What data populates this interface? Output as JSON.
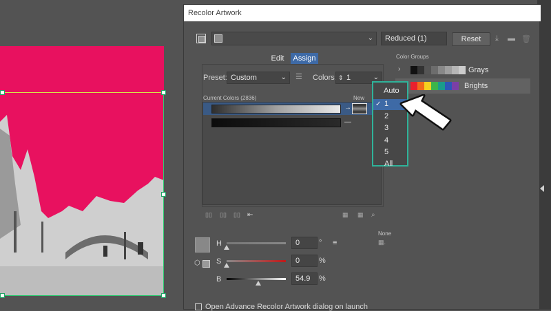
{
  "dialog": {
    "title": "Recolor Artwork",
    "preset_group_name": "Reduced (1)",
    "reset_label": "Reset",
    "tabs": {
      "edit": "Edit",
      "assign": "Assign"
    },
    "preset_label": "Preset:",
    "preset_value": "Custom",
    "colors_label": "Colors:",
    "colors_value": "1",
    "current_colors_label": "Current Colors (2836)",
    "new_label": "New",
    "none_label": "None",
    "checkbox_label": "Open Advance Recolor Artwork dialog on launch"
  },
  "color_groups": {
    "heading": "Color Groups",
    "items": [
      {
        "label": "Grays"
      },
      {
        "label": "Brights"
      }
    ]
  },
  "colors_dropdown": {
    "options": [
      "Auto",
      "1",
      "2",
      "3",
      "4",
      "5",
      "All"
    ],
    "selected": "1"
  },
  "hsb": {
    "h_label": "H",
    "h_value": "0",
    "h_unit": "°",
    "s_label": "S",
    "s_value": "0",
    "s_unit": "%",
    "b_label": "B",
    "b_value": "54.9",
    "b_unit": "%"
  },
  "colors": {
    "accent_teal": "#2fb39a",
    "selection_blue": "#3e6aa6",
    "artwork_pink": "#e8115f"
  }
}
